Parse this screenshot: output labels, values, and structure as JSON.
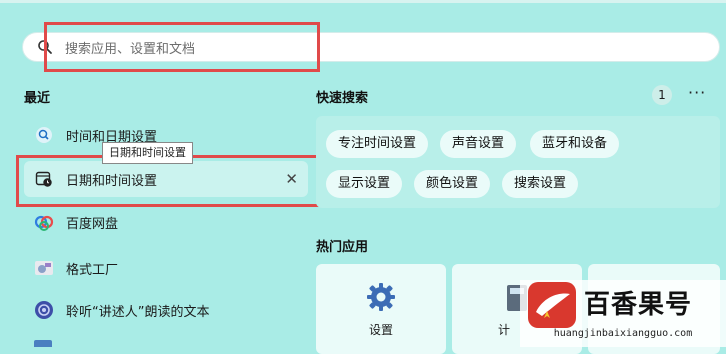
{
  "search": {
    "placeholder": "搜索应用、设置和文档"
  },
  "recent": {
    "title": "最近",
    "items": [
      {
        "label": "时间和日期设置",
        "icon": "search-icon"
      },
      {
        "label": "日期和时间设置",
        "icon": "clock-calendar-icon",
        "selected": true
      },
      {
        "label": "百度网盘",
        "icon": "baidu-netdisk-icon"
      },
      {
        "label": "格式工厂",
        "icon": "format-factory-icon"
      },
      {
        "label": "聆听“讲述人”朗读的文本",
        "icon": "narrator-icon"
      }
    ],
    "tooltip": "日期和时间设置"
  },
  "quick_search": {
    "title": "快速搜索",
    "badge": "1",
    "more": "···",
    "pills": [
      "专注时间设置",
      "声音设置",
      "蓝牙和设备",
      "显示设置",
      "颜色设置",
      "搜索设置"
    ]
  },
  "hot_apps": {
    "title": "热门应用",
    "apps": [
      {
        "label": "设置",
        "icon": "gear-icon"
      },
      {
        "label": "计",
        "icon": "calculator-icon"
      }
    ]
  },
  "watermark": {
    "title": "百香果号",
    "url": "huangjinbaixiangguo.com"
  },
  "colors": {
    "background": "#a9ece6",
    "highlight": "#e04a4a",
    "panel": "#eafbf9"
  }
}
